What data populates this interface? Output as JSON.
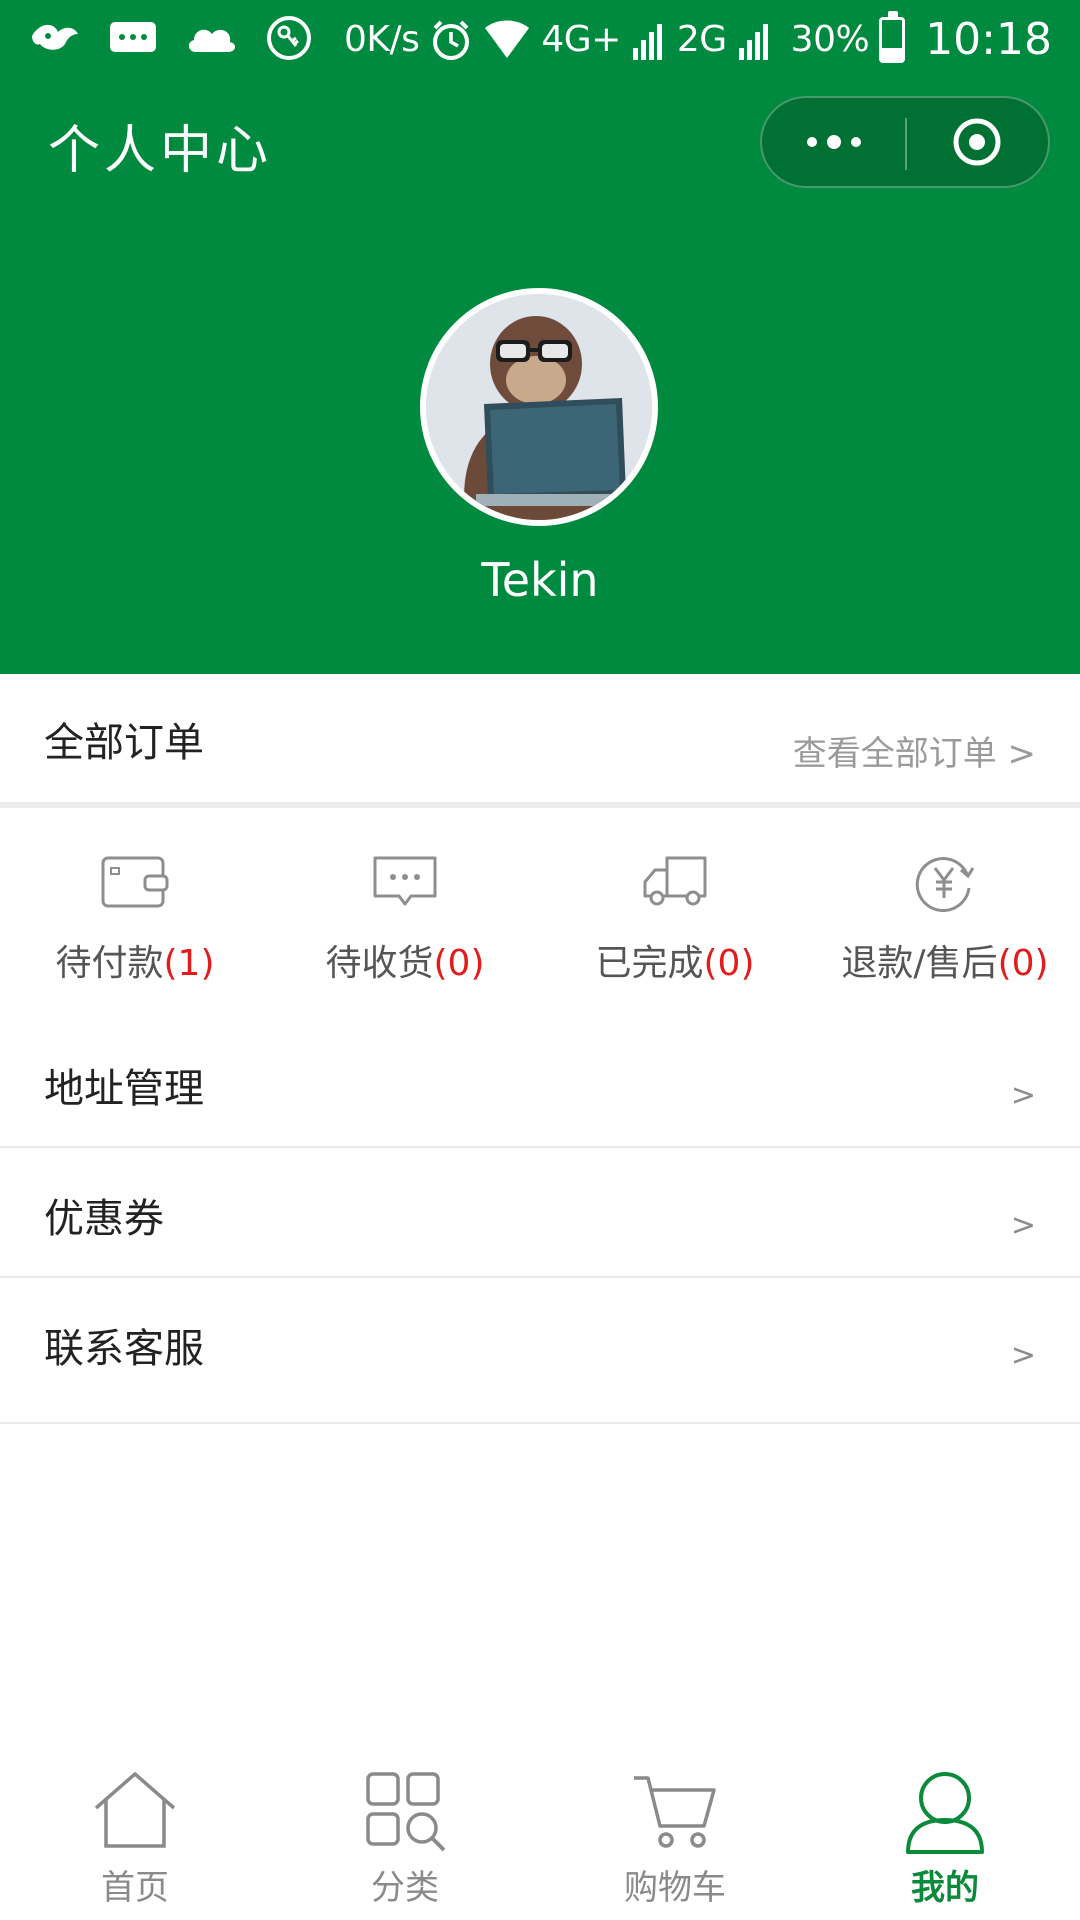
{
  "status_bar": {
    "net_speed": "0K/s",
    "network_1": "4G+",
    "network_2": "2G",
    "battery_percent": "30%",
    "battery_level": 0.3,
    "time": "10:18",
    "icons": [
      "bird-logo-icon",
      "message-icon",
      "cloud-icon",
      "key-icon",
      "alarm-icon",
      "wifi-icon",
      "signal-icon",
      "signal-icon",
      "battery-icon"
    ]
  },
  "header": {
    "title": "个人中心",
    "capsule_icons": [
      "more-dots-icon",
      "close-target-icon"
    ],
    "background_color": "#008a3f"
  },
  "profile": {
    "username": "Tekin",
    "avatar": "avatar-image"
  },
  "orders": {
    "title": "全部订单",
    "view_all": "查看全部订单 >",
    "statuses": [
      {
        "label": "待付款",
        "count": "(1)",
        "icon": "wallet-icon"
      },
      {
        "label": "待收货",
        "count": "(0)",
        "icon": "message-box-icon"
      },
      {
        "label": "已完成",
        "count": "(0)",
        "icon": "truck-icon"
      },
      {
        "label": "退款/售后",
        "count": "(0)",
        "icon": "refund-yen-icon"
      }
    ],
    "count_color": "#e21c1c"
  },
  "menu": [
    {
      "label": "地址管理",
      "chevron": ">"
    },
    {
      "label": "优惠券",
      "chevron": ">"
    },
    {
      "label": "联系客服",
      "chevron": ">"
    }
  ],
  "tabbar": {
    "items": [
      {
        "label": "首页",
        "icon": "home-icon",
        "active": false
      },
      {
        "label": "分类",
        "icon": "category-icon",
        "active": false
      },
      {
        "label": "购物车",
        "icon": "cart-icon",
        "active": false
      },
      {
        "label": "我的",
        "icon": "user-icon",
        "active": true
      }
    ],
    "active_color": "#0c8a3c",
    "inactive_color": "#8a8a8a"
  }
}
